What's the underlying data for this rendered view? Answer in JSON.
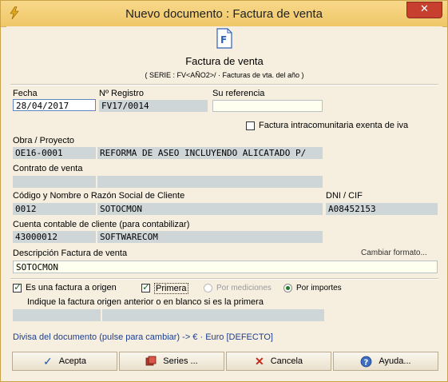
{
  "window": {
    "title": "Nuevo documento : Factura de venta",
    "close_glyph": "✕"
  },
  "header": {
    "title": "Factura de venta",
    "subtitle": "( SERIE : FV<AÑO2>/ · Facturas  de vta. del año )",
    "doc_icon_letter": "F"
  },
  "fecha": {
    "label": "Fecha",
    "value": "28/04/2017"
  },
  "registro": {
    "label": "Nº Registro",
    "value": "FV17/0014"
  },
  "referencia": {
    "label": "Su referencia",
    "value": ""
  },
  "intracom": {
    "label": "Factura intracomunitaria exenta de iva",
    "checked": false
  },
  "obra": {
    "label": "Obra / Proyecto",
    "code": "OE16-0001",
    "name": "REFORMA DE ASEO INCLUYENDO ALICATADO P/"
  },
  "contrato": {
    "label": "Contrato de venta",
    "code": "",
    "name": ""
  },
  "cliente": {
    "label": "Código y Nombre o Razón Social de Cliente",
    "code": "0012",
    "name": "SOTOCMON",
    "dni_label": "DNI / CIF",
    "dni": "A08452153"
  },
  "cuenta": {
    "label": "Cuenta contable de cliente (para contabilizar)",
    "code": "43000012",
    "name": "SOFTWARECOM"
  },
  "descripcion": {
    "label": "Descripción Factura de venta",
    "value": "SOTOCMON",
    "cambiar_link": "Cambiar formato..."
  },
  "origen": {
    "es_origen_label": "Es una factura a origen",
    "es_origen_checked": true,
    "primera_label": "Primera",
    "primera_checked": true,
    "por_mediciones_label": "Por mediciones",
    "por_importes_label": "Por importes",
    "selected": "Por importes",
    "indique_label": "Indique la factura origen anterior o en blanco si es la primera",
    "anterior_code": "",
    "anterior_name": ""
  },
  "divisa": {
    "text": "Divisa del documento (pulse para cambiar) -> € · Euro [DEFECTO]"
  },
  "buttons": {
    "acepta": "Acepta",
    "series": "Series ...",
    "cancela": "Cancela",
    "ayuda": "Ayuda..."
  },
  "colors": {
    "accent": "#1d3f8f",
    "titlebar": "#f0c768",
    "field": "#cfd6d7"
  }
}
